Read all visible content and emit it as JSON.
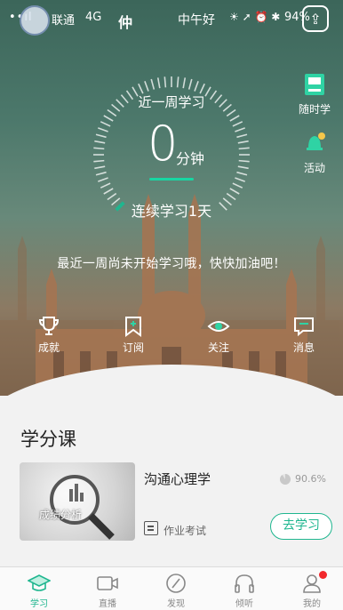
{
  "status_bar": {
    "signal": "••ıl",
    "carrier": "联通",
    "network": "4G",
    "title": "仲",
    "greeting": "中午好",
    "battery": "94%"
  },
  "stats": {
    "label": "近一周学习",
    "value": "0",
    "unit": "分钟",
    "streak": "连续学习1天",
    "hint": "最近一周尚未开始学习哦，快快加油吧！"
  },
  "side_actions": [
    {
      "label": "随时学",
      "icon": "book-icon"
    },
    {
      "label": "活动",
      "icon": "bell-icon"
    }
  ],
  "quick_actions": [
    {
      "label": "成就",
      "icon": "trophy-icon"
    },
    {
      "label": "订阅",
      "icon": "bookmark-icon"
    },
    {
      "label": "关注",
      "icon": "eye-icon"
    },
    {
      "label": "消息",
      "icon": "message-icon"
    }
  ],
  "section": {
    "title": "学分课"
  },
  "course": {
    "name": "沟通心理学",
    "progress_percent": 90.6,
    "progress_text": "90.6%",
    "meta": "作业考试",
    "button": "去学习",
    "thumb_caption": "成绩分析"
  },
  "tabs": [
    {
      "label": "学习",
      "icon": "mortarboard-icon",
      "active": true
    },
    {
      "label": "直播",
      "icon": "video-icon",
      "active": false
    },
    {
      "label": "发现",
      "icon": "compass-icon",
      "active": false
    },
    {
      "label": "倾听",
      "icon": "headphones-icon",
      "active": false
    },
    {
      "label": "我的",
      "icon": "profile-icon",
      "active": false
    }
  ],
  "colors": {
    "accent": "#1fb68f",
    "badge": "#f2282c"
  }
}
